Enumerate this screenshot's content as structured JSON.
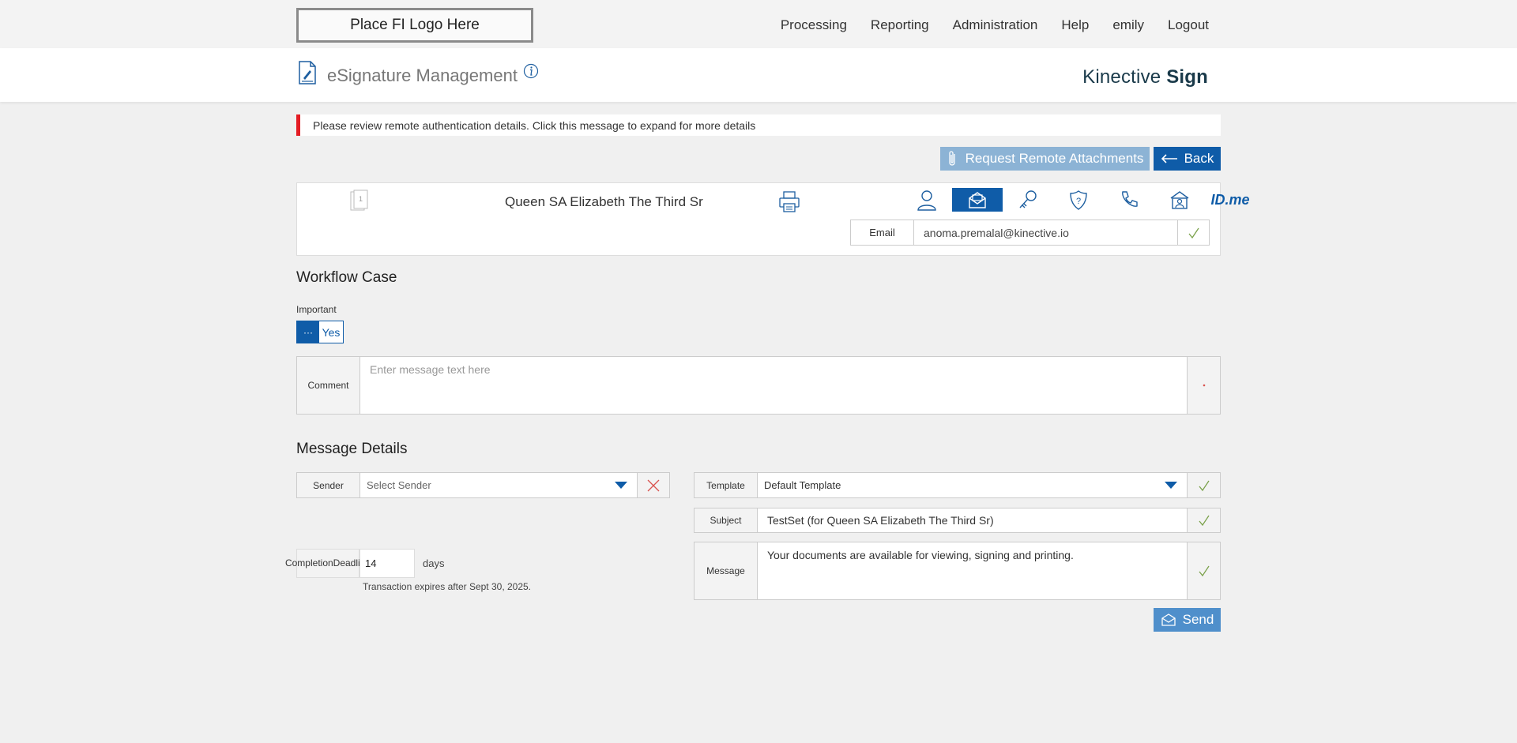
{
  "header": {
    "logo_placeholder": "Place FI Logo Here",
    "nav": [
      "Processing",
      "Reporting",
      "Administration",
      "Help",
      "emily",
      "Logout"
    ]
  },
  "titlebar": {
    "title": "eSignature Management",
    "brand_light": "Kinective",
    "brand_bold": "Sign"
  },
  "alert": {
    "text": "Please review remote authentication details. Click this message to expand for more details",
    "color": "#e41c23"
  },
  "actions": {
    "request_attachments": "Request Remote Attachments",
    "back": "Back"
  },
  "recipient": {
    "doc_number": "1",
    "name": "Queen SA Elizabeth The Third Sr",
    "auth_methods": [
      "user-icon",
      "email-icon",
      "key-icon",
      "security-question-icon",
      "phone-icon",
      "in-person-icon",
      "ID.me"
    ],
    "active_auth": "email-icon",
    "email_label": "Email",
    "email_value": "anoma.premalal@kinective.io"
  },
  "workflow": {
    "title": "Workflow Case",
    "important_label": "Important",
    "toggle_knob": "···",
    "toggle_value": "Yes",
    "comment_label": "Comment",
    "comment_placeholder": "Enter message text here"
  },
  "message": {
    "title": "Message Details",
    "sender_label": "Sender",
    "sender_placeholder": "Select Sender",
    "template_label": "Template",
    "template_value": "Default Template",
    "subject_label": "Subject",
    "subject_value": "TestSet (for Queen SA Elizabeth The Third Sr)",
    "message_label": "Message",
    "message_value": "Your documents are available for viewing, signing and printing.",
    "deadline_label_1": "Completion",
    "deadline_label_2": "Deadline",
    "deadline_value": "14",
    "deadline_unit": "days",
    "expires_text": "Transaction expires after Sept 30, 2025.",
    "send": "Send"
  },
  "colors": {
    "primary": "#0f5ca8",
    "primary_light": "#8cb3d5",
    "check": "#7aa14a",
    "error": "#d9534f"
  }
}
